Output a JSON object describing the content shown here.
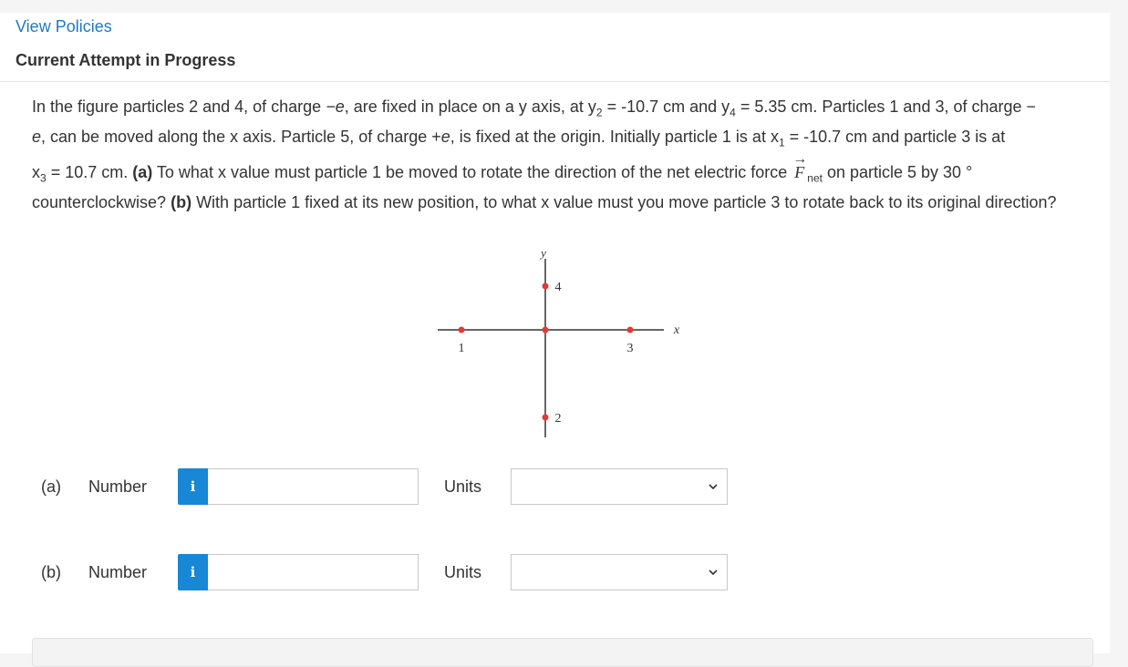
{
  "header": {
    "policies_link": "View Policies",
    "attempt_title": "Current Attempt in Progress"
  },
  "question": {
    "seg1": "In the figure particles 2 and 4, of charge ",
    "charge_neg": "−e",
    "seg2": ", are fixed in place on a y axis, at ",
    "y2_var": "y",
    "y2_sub": "2",
    "y2_val": " = -10.7 cm and ",
    "y4_var": "y",
    "y4_sub": "4",
    "y4_val": " = 5.35 cm. Particles 1 and 3, of charge −",
    "seg3_e": "e",
    "seg3": ", can be moved along the x axis. Particle 5, of charge +",
    "seg3_e2": "e",
    "seg4": ", is fixed at the origin. Initially particle 1 is at ",
    "x1_var": "x",
    "x1_sub": "1",
    "x1_val": " = -10.7 cm and particle 3 is at ",
    "x3_var": "x",
    "x3_sub": "3",
    "x3_val": " = 10.7 cm. ",
    "part_a_tag": "(a)",
    "part_a_text": " To what x value must particle 1 be moved to rotate the direction of the net electric force ",
    "force_symbol": "F",
    "force_arrow": "→",
    "force_sub": "net",
    "part_a_text2": " on particle 5 by 30 ° counterclockwise? ",
    "part_b_tag": "(b)",
    "part_b_text": " With particle 1 fixed at its new position, to what x value must you move particle 3 to rotate back to its original direction?"
  },
  "figure": {
    "axis_y_label": "y",
    "axis_x_label": "x",
    "particle_labels": [
      "1",
      "2",
      "3",
      "4"
    ],
    "particle_color": "#e53935"
  },
  "answers": [
    {
      "part": "(a)",
      "number_label": "Number",
      "info_icon": "i",
      "value": "",
      "units_label": "Units",
      "units_selected": ""
    },
    {
      "part": "(b)",
      "number_label": "Number",
      "info_icon": "i",
      "value": "",
      "units_label": "Units",
      "units_selected": ""
    }
  ],
  "colors": {
    "link": "#1f7bc1",
    "info_button": "#1787d6"
  }
}
